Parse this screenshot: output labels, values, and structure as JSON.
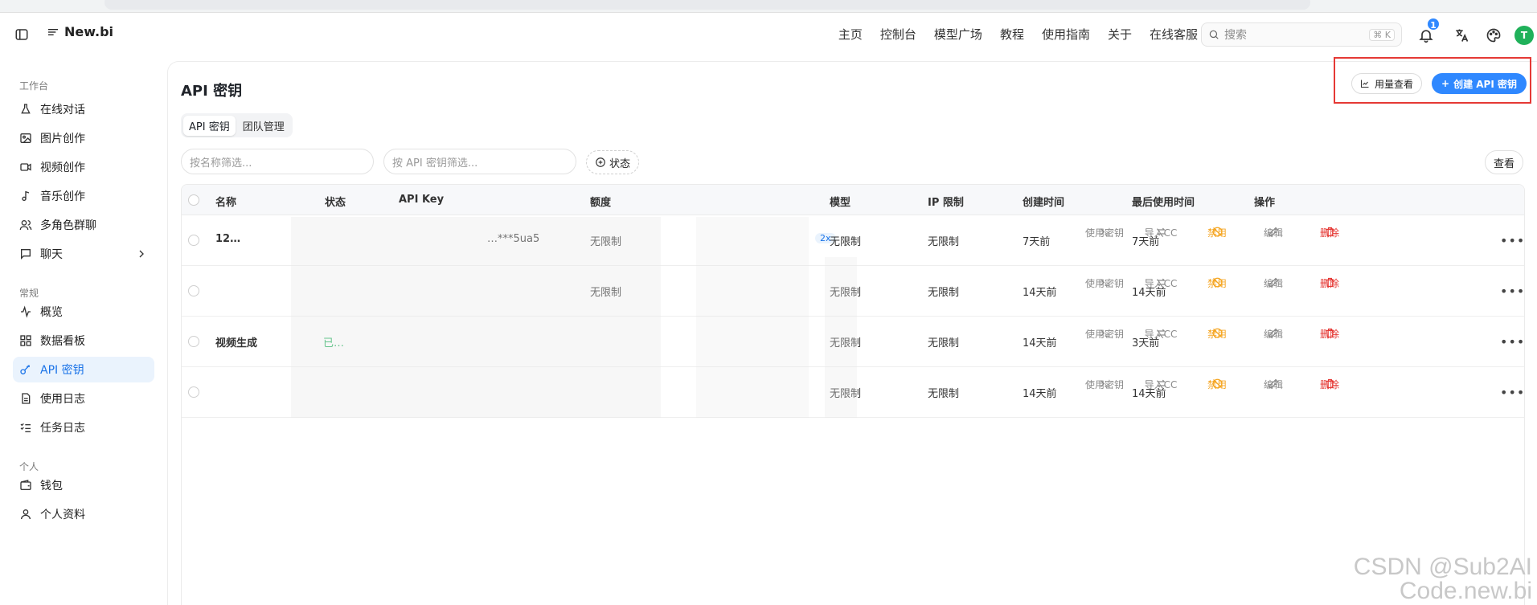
{
  "brand": {
    "name": "New.bi"
  },
  "nav": [
    "主页",
    "控制台",
    "模型广场",
    "教程",
    "使用指南",
    "关于",
    "在线客服"
  ],
  "search": {
    "placeholder": "搜索",
    "shortcut": "⌘ K"
  },
  "notifications": {
    "count": "1"
  },
  "user": {
    "initial": "T"
  },
  "sidebar": {
    "sections": [
      {
        "title": "工作台",
        "items": [
          {
            "label": "在线对话",
            "icon": "flask-icon"
          },
          {
            "label": "图片创作",
            "icon": "image-icon"
          },
          {
            "label": "视频创作",
            "icon": "video-icon"
          },
          {
            "label": "音乐创作",
            "icon": "music-icon"
          },
          {
            "label": "多角色群聊",
            "icon": "users-icon"
          },
          {
            "label": "聊天",
            "icon": "chat-icon",
            "expandable": true
          }
        ]
      },
      {
        "title": "常规",
        "items": [
          {
            "label": "概览",
            "icon": "activity-icon"
          },
          {
            "label": "数据看板",
            "icon": "dashboard-icon"
          },
          {
            "label": "API 密钥",
            "icon": "key-icon",
            "active": true
          },
          {
            "label": "使用日志",
            "icon": "log-icon"
          },
          {
            "label": "任务日志",
            "icon": "task-icon"
          }
        ]
      },
      {
        "title": "个人",
        "items": [
          {
            "label": "钱包",
            "icon": "wallet-icon"
          },
          {
            "label": "个人资料",
            "icon": "user-icon"
          }
        ]
      }
    ]
  },
  "page": {
    "title": "API 密钥",
    "usage_button": "用量查看",
    "create_button": "创建 API 密钥",
    "tabs": [
      "API 密钥",
      "团队管理"
    ],
    "filter_name_placeholder": "按名称筛选...",
    "filter_key_placeholder": "按 API 密钥筛选...",
    "status_filter": "状态",
    "view_button": "查看"
  },
  "table": {
    "columns": [
      "名称",
      "状态",
      "API Key",
      "额度",
      "模型",
      "IP 限制",
      "创建时间",
      "最后使用时间",
      "操作"
    ],
    "rows": [
      {
        "name": "12…",
        "status": "",
        "api_key": "…***5ua5",
        "quota": "无限制",
        "model": "无限制",
        "ip": "无限制",
        "created": "7天前",
        "last_used": "7天前"
      },
      {
        "name": "",
        "status": "",
        "api_key": "",
        "quota": "无限制",
        "model": "无限制",
        "ip": "无限制",
        "created": "14天前",
        "last_used": "14天前"
      },
      {
        "name": "视频生成",
        "status": "已…",
        "api_key": "",
        "quota": "",
        "model": "无限制",
        "ip": "无限制",
        "created": "14天前",
        "last_used": "3天前"
      },
      {
        "name": "",
        "status": "",
        "api_key": "",
        "quota": "",
        "model": "无限制",
        "ip": "无限制",
        "created": "14天前",
        "last_used": "14天前"
      }
    ],
    "actions": [
      "使用密钥",
      "导入CC",
      "禁用",
      "编辑",
      "删除"
    ],
    "tag_label": "2x"
  },
  "watermark": {
    "line1": "CSDN @Sub2AI",
    "line2": "Code.new.bi"
  },
  "colors": {
    "accent": "#2f88ff",
    "danger": "#e53935",
    "warning": "#f5a623",
    "success": "#20b15a"
  }
}
